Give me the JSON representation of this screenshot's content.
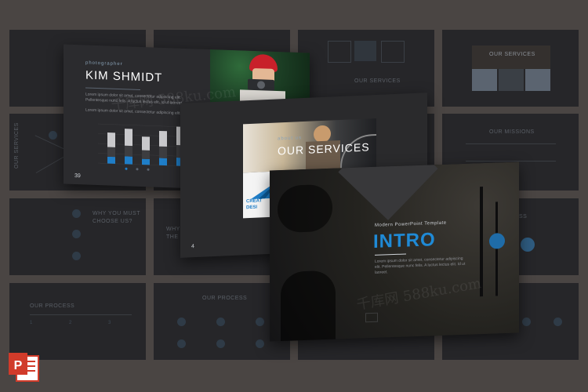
{
  "background_color": "#4a4543",
  "grid_slides": {
    "our_services_top": "OUR SERVICES",
    "our_services_right": "OUR SERVICES",
    "our_missions": "OUR MISSIONS",
    "our_services_vertical": "OUR SERVICES",
    "why_you_must": "WHY YOU MUST",
    "choose_us": "CHOOSE US?",
    "why_partial": "WHY",
    "the_partial": "THE",
    "our_process_left": "OUR PROCESS",
    "our_process_mid": "OUR PROCESS",
    "ss_partial": "SS",
    "page_num_grid": "4"
  },
  "slide_profile": {
    "subtitle": "photographer",
    "name": "KIM SHMIDT",
    "body1": "Lorem ipsum dolor sit amet, consectetur adipiscing elit. Pellentesque nunc felis. A luctus lectus elit. Id ut laoreet.",
    "body2": "Lorem ipsum dolor sit amet, consectetur adipiscing elit.",
    "page_number": "39",
    "chart_data": {
      "type": "bar",
      "categories": [
        "1",
        "2",
        "3",
        "4",
        "5"
      ],
      "series": [
        {
          "values": [
            30,
            35,
            28,
            32,
            38
          ]
        },
        {
          "values": [
            20,
            22,
            18,
            24,
            26
          ]
        },
        {
          "values": [
            14,
            16,
            12,
            15,
            17
          ]
        }
      ]
    }
  },
  "slide_services": {
    "subtitle": "about us",
    "title": "OUR SERVICES",
    "logo_text_line1": "CREAT",
    "logo_text_line2": "DESI",
    "page_number": "4"
  },
  "slide_intro": {
    "subtitle": "Modern PowerPoint Template",
    "title": "INTRO",
    "body": "Lorem ipsum dolor sit amet, consectetur adipiscing elit. Pellentesque nunc felis. A luctus lectus elit. Id ut laoreet."
  },
  "watermark": "千库网 588ku.com",
  "icons": {
    "app_icon": "powerpoint-icon"
  },
  "colors": {
    "accent_blue": "#1f7ec8",
    "slide_dark": "#2a2a2c",
    "intro_blue": "#1f8ad6",
    "hat_red": "#c8202a",
    "pp_red": "#d13b2a"
  }
}
